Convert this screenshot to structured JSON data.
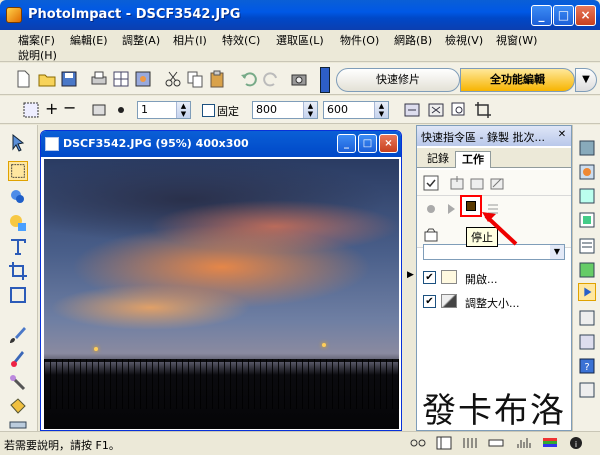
{
  "window": {
    "title": "PhotoImpact - DSCF3542.JPG"
  },
  "menu": {
    "row1": [
      "檔案(F)",
      "編輯(E)",
      "調整(A)",
      "相片(I)",
      "特效(C)",
      "選取區(L)",
      "物件(O)",
      "網路(B)",
      "檢視(V)",
      "視窗(W)"
    ],
    "row2": [
      "說明(H)"
    ]
  },
  "toolbar": {
    "mode_quick": "快速修片",
    "mode_full": "全功能編輯"
  },
  "attrbar": {
    "brush_size": "1",
    "fixed_label": "固定",
    "width": "800",
    "height": "600"
  },
  "document": {
    "title": "DSCF3542.JPG (95%) 400x300"
  },
  "panel": {
    "title": "快速指令區 - 錄製 批次...",
    "tabs": [
      "記錄",
      "工作"
    ],
    "active_tab": "工作",
    "tooltip": "停止",
    "items": [
      {
        "label": "開啟...",
        "checked": true
      },
      {
        "label": "調整大小...",
        "checked": true
      }
    ],
    "watermark": "發卡布洛"
  },
  "status": {
    "text": "若需要說明，請按 F1。"
  },
  "colors": {
    "highlight": "#ff0000",
    "title_blue": "#0058e6",
    "mode_active": "#f7b400"
  }
}
